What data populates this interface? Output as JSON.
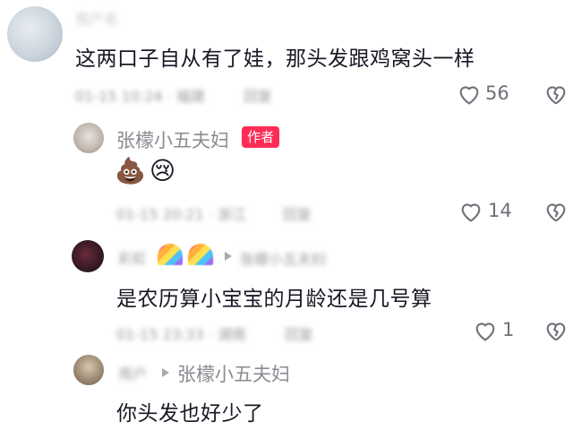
{
  "comments": [
    {
      "text": "这两口子自从有了娃，那头发跟鸡窝头一样",
      "likes": "56",
      "username_blurred": "用户名",
      "meta_blurred": "01-15 10:24 · 福建",
      "reply_blurred": "回复"
    },
    {
      "username": "张檬小五夫妇",
      "badge": "作者",
      "text": "💩😢",
      "likes": "14",
      "meta_blurred": "01-15 20:21 · 浙江",
      "reply_blurred": "回复"
    },
    {
      "username_blurred": "彩虹",
      "reply_to_blurred": "张檬小五夫妇",
      "text": "是农历算小宝宝的月龄还是几号算",
      "likes": "1",
      "meta_blurred": "01-15 23:33 · 湖南",
      "reply_blurred": "回复"
    },
    {
      "username_blurred": "用户",
      "reply_to": "张檬小五夫妇",
      "text": "你头发也好少了"
    }
  ],
  "colors": {
    "text": "#161823",
    "secondary": "#8a8b91",
    "badge": "#fe2c55"
  },
  "icons": [
    "heart-icon",
    "broken-heart-icon",
    "reply-arrow-icon"
  ]
}
